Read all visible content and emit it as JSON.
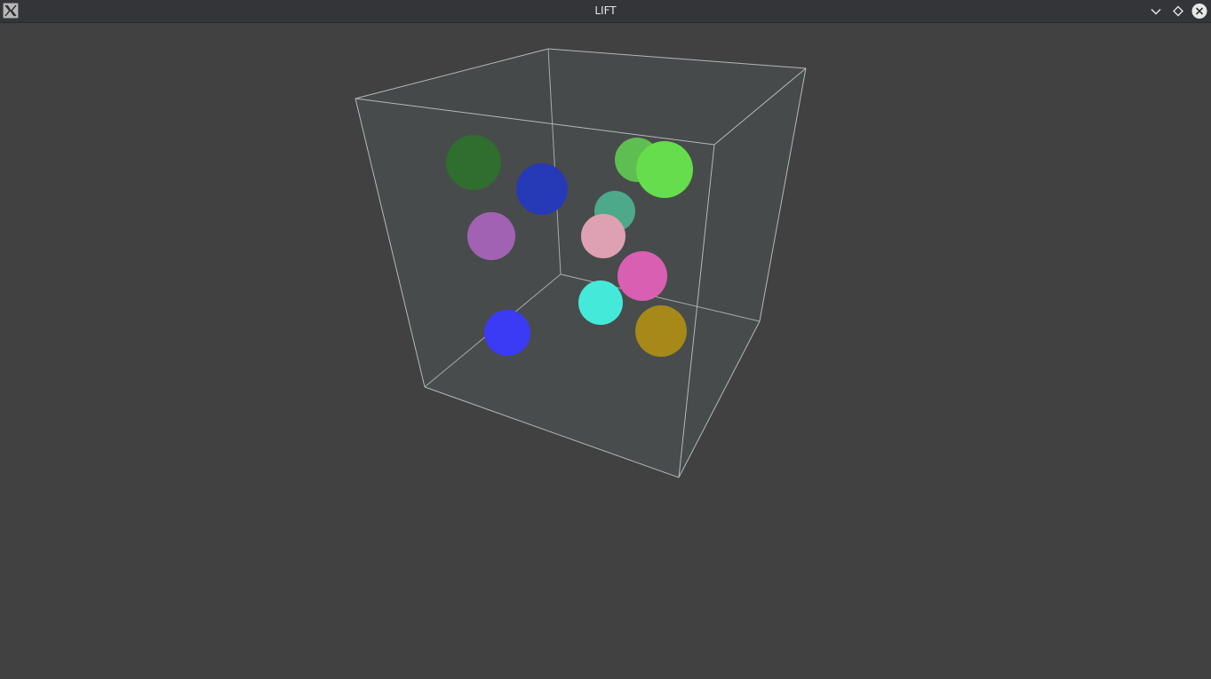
{
  "window": {
    "title": "LIFT",
    "icon": "x11-app-icon"
  },
  "controls": {
    "minimize_icon": "chevron-down-icon",
    "maximize_icon": "diamond-icon",
    "close_icon": "close-circle-icon"
  },
  "colors": {
    "background": "#414141",
    "titlebar": "#333539",
    "box_face": "#474a4a",
    "box_edge": "#b4b8b8",
    "spheres": [
      "#2f6e2e",
      "#2639b7",
      "#a262b3",
      "#5fbe52",
      "#66dd4c",
      "#4ea88a",
      "#dea1b3",
      "#d95fb3",
      "#45e9da",
      "#a68918",
      "#3b3af5"
    ]
  }
}
